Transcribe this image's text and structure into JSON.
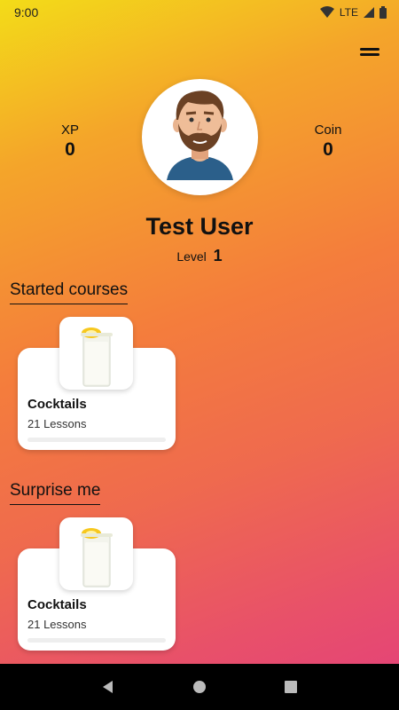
{
  "status_bar": {
    "time": "9:00",
    "network": "LTE"
  },
  "profile": {
    "xp_label": "XP",
    "xp_value": "0",
    "coin_label": "Coin",
    "coin_value": "0",
    "name": "Test User",
    "level_label": "Level",
    "level_value": "1"
  },
  "sections": {
    "started": {
      "title": "Started courses",
      "course": {
        "title": "Cocktails",
        "lessons": "21 Lessons",
        "progress": 0
      }
    },
    "surprise": {
      "title": "Surprise me",
      "course": {
        "title": "Cocktails",
        "lessons": "21 Lessons",
        "progress": 0
      }
    }
  },
  "colors": {
    "gradient_top": "#f3dc18",
    "gradient_mid": "#f47d3c",
    "gradient_bottom": "#e3407b"
  }
}
